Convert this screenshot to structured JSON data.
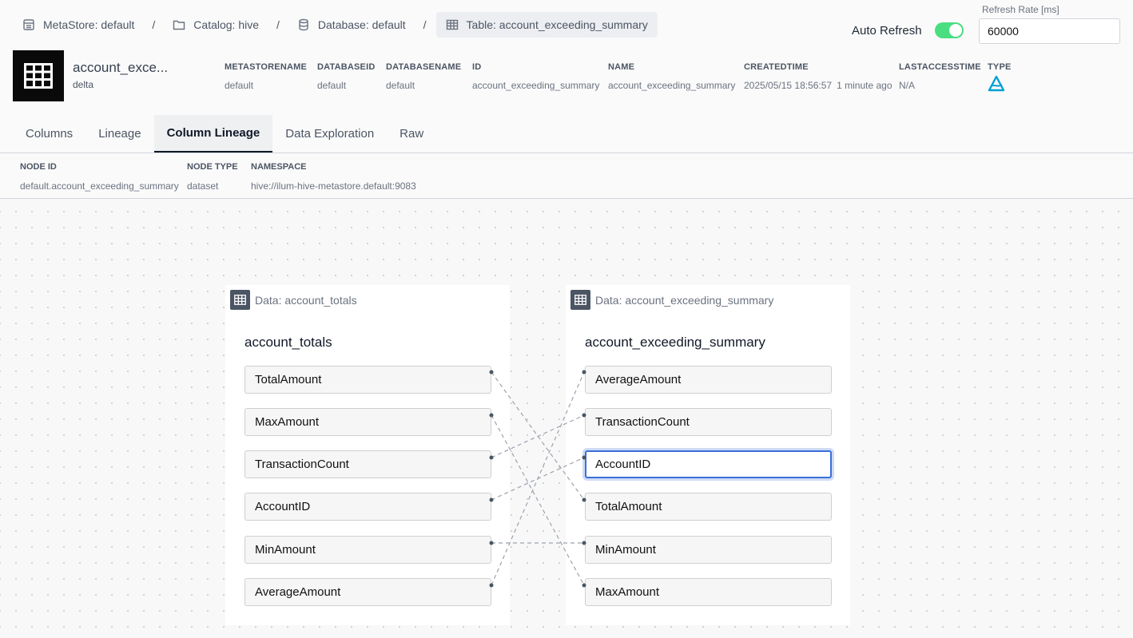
{
  "breadcrumb": [
    {
      "label": "MetaStore: default",
      "icon": "metastore-icon"
    },
    {
      "label": "Catalog: hive",
      "icon": "folder-icon"
    },
    {
      "label": "Database: default",
      "icon": "database-icon"
    },
    {
      "label": "Table: account_exceeding_summary",
      "icon": "table-icon"
    }
  ],
  "breadcrumb_separator": "/",
  "refresh": {
    "auto_label": "Auto Refresh",
    "auto_enabled": true,
    "rate_label": "Refresh Rate [ms]",
    "rate_value": "60000",
    "toggle_color": "#4ade80"
  },
  "table": {
    "name": "account_exce...",
    "format": "delta",
    "meta": [
      {
        "head": "METASTORENAME",
        "value": "default"
      },
      {
        "head": "DATABASEID",
        "value": "default"
      },
      {
        "head": "DATABASENAME",
        "value": "default"
      },
      {
        "head": "ID",
        "value": "account_exceeding_summary"
      },
      {
        "head": "NAME",
        "value": "account_exceeding_summary"
      },
      {
        "head": "CREATEDTIME",
        "value": "2025/05/15  18:56:57",
        "sub": "1 minute ago"
      },
      {
        "head": "LASTACCESSTIME",
        "value": "N/A"
      },
      {
        "head": "TYPE",
        "value": "",
        "icon": "delta-lake-icon",
        "icon_color": "#00a0d6"
      }
    ]
  },
  "tabs": [
    {
      "label": "Columns",
      "active": false
    },
    {
      "label": "Lineage",
      "active": false
    },
    {
      "label": "Column Lineage",
      "active": true
    },
    {
      "label": "Data Exploration",
      "active": false
    },
    {
      "label": "Raw",
      "active": false
    }
  ],
  "node_info": [
    {
      "head": "NODE ID",
      "value": "default.account_exceeding_summary"
    },
    {
      "head": "NODE TYPE",
      "value": "dataset"
    },
    {
      "head": "NAMESPACE",
      "value": "hive://ilum-hive-metastore.default:9083"
    }
  ],
  "lineage": {
    "source": {
      "header": "Data: account_totals",
      "title": "account_totals",
      "fields": [
        "TotalAmount",
        "MaxAmount",
        "TransactionCount",
        "AccountID",
        "MinAmount",
        "AverageAmount"
      ]
    },
    "target": {
      "header": "Data: account_exceeding_summary",
      "title": "account_exceeding_summary",
      "fields": [
        "AverageAmount",
        "TransactionCount",
        "AccountID",
        "TotalAmount",
        "MinAmount",
        "MaxAmount"
      ],
      "selected": "AccountID"
    },
    "edges": [
      [
        "TotalAmount",
        "TotalAmount"
      ],
      [
        "MaxAmount",
        "MaxAmount"
      ],
      [
        "TransactionCount",
        "TransactionCount"
      ],
      [
        "AccountID",
        "AccountID"
      ],
      [
        "MinAmount",
        "MinAmount"
      ],
      [
        "AverageAmount",
        "AverageAmount"
      ]
    ]
  }
}
